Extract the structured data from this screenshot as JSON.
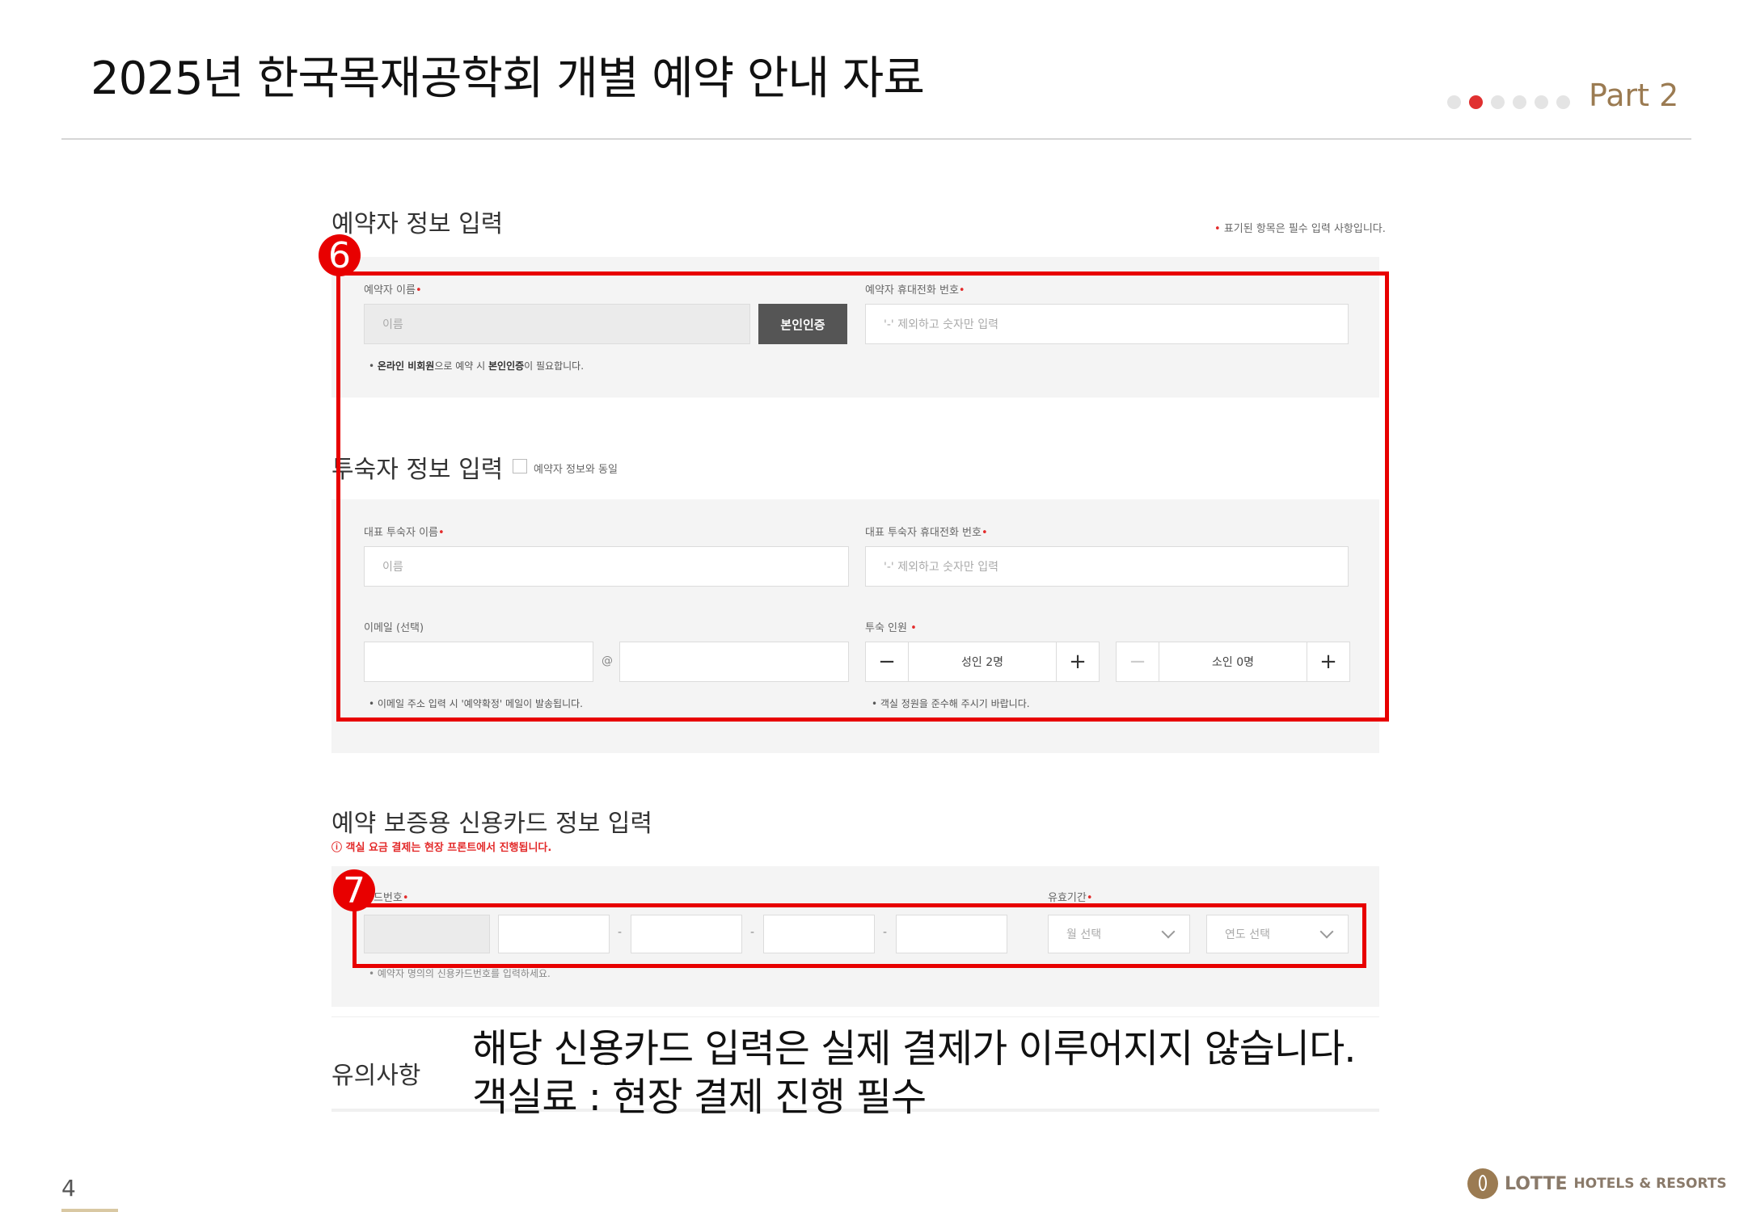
{
  "slide": {
    "title": "2025년 한국목재공학회 개별 예약 안내 자료",
    "part": "Part 2",
    "page_number": "4",
    "pager_dots": 6,
    "pager_active": 1,
    "logo_primary": "LOTTE",
    "logo_secondary": "HOTELS & RESORTS"
  },
  "booker": {
    "section_title": "예약자 정보 입력",
    "required_note_mark": "•",
    "required_note": "표기된 항목은 필수 입력 사항입니다.",
    "name_label": "예약자 이름",
    "name_placeholder": "이름",
    "verify_button": "본인인증",
    "phone_label": "예약자 휴대전화 번호",
    "phone_placeholder": "'-' 제외하고 숫자만 입력",
    "note_prefix": "• ",
    "note_bold1": "온라인 비회원",
    "note_mid": "으로 예약 시 ",
    "note_bold2": "본인인증",
    "note_suffix": "이 필요합니다."
  },
  "guest": {
    "section_title": "투숙자 정보 입력",
    "same_as_booker": "예약자 정보와 동일",
    "name_label": "대표 투숙자 이름",
    "name_placeholder": "이름",
    "phone_label": "대표 투숙자 휴대전화 번호",
    "phone_placeholder": "'-' 제외하고 숫자만 입력",
    "email_label": "이메일 (선택)",
    "email_at": "@",
    "email_note": "• 이메일 주소 입력 시 '예약확정' 메일이 발송됩니다.",
    "count_label": "투숙 인원",
    "count_mark": "•",
    "adult_value": "성인 2명",
    "child_value": "소인 0명",
    "minus": "−",
    "plus": "+",
    "count_note": "• 객실 정원을 준수해 주시기 바랍니다."
  },
  "card": {
    "section_title": "예약 보증용 신용카드 정보 입력",
    "warning": "ⓘ 객실 요금 결제는 현장 프론트에서 진행됩니다.",
    "number_label": "카드번호",
    "expiry_label": "유효기간",
    "dash": "-",
    "month_select": "월 선택",
    "year_select": "연도 선택",
    "note": "• 예약자 명의의 신용카드번호를 입력하세요."
  },
  "caution": {
    "title": "유의사항"
  },
  "annotation": {
    "badge6": "6",
    "badge7": "7",
    "line1": "해당 신용카드 입력은 실제 결제가 이루어지지 않습니다.",
    "line2": "객실료 : 현장 결제 진행 필수"
  },
  "colors": {
    "highlight_red": "#e80000",
    "accent_gold": "#9b7b52",
    "required_red": "#e32b2b"
  }
}
